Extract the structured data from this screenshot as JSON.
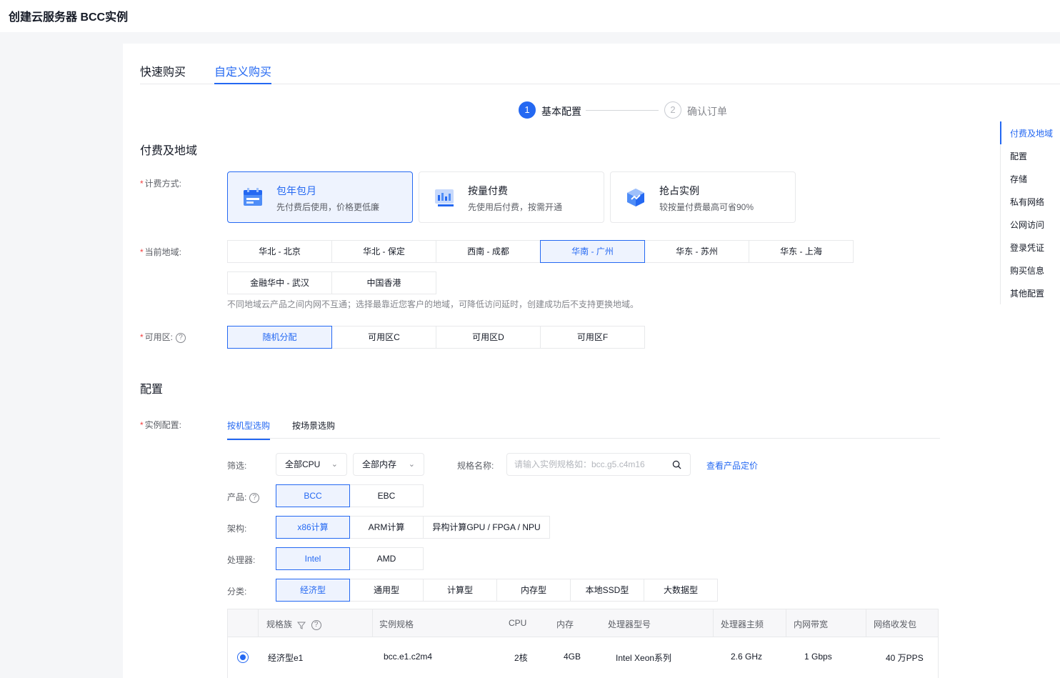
{
  "page": {
    "title": "创建云服务器 BCC实例"
  },
  "tabs": [
    {
      "label": "快速购买",
      "active": false
    },
    {
      "label": "自定义购买",
      "active": true
    }
  ],
  "steps": [
    {
      "num": "1",
      "label": "基本配置",
      "active": true
    },
    {
      "num": "2",
      "label": "确认订单",
      "active": false
    }
  ],
  "sections": {
    "billing_region": "付费及地域",
    "config": "配置"
  },
  "billing": {
    "label": "计费方式:",
    "options": [
      {
        "title": "包年包月",
        "desc": "先付费后使用，价格更低廉",
        "selected": true,
        "icon": "calendar-icon"
      },
      {
        "title": "按量付费",
        "desc": "先使用后付费，按需开通",
        "selected": false,
        "icon": "meter-icon"
      },
      {
        "title": "抢占实例",
        "desc": "较按量付费最高可省90%",
        "selected": false,
        "icon": "cube-icon"
      }
    ]
  },
  "region": {
    "label": "当前地域:",
    "row1": [
      "华北 - 北京",
      "华北 - 保定",
      "西南 - 成都",
      "华南 - 广州",
      "华东 - 苏州",
      "华东 - 上海"
    ],
    "row2": [
      "金融华中 - 武汉",
      "中国香港"
    ],
    "selected": "华南 - 广州",
    "hint": "不同地域云产品之间内网不互通；选择最靠近您客户的地域，可降低访问延时，创建成功后不支持更换地域。"
  },
  "zone": {
    "label": "可用区:",
    "options": [
      "随机分配",
      "可用区C",
      "可用区D",
      "可用区F"
    ],
    "selected": "随机分配"
  },
  "instance": {
    "label": "实例配置:",
    "subtabs": [
      {
        "label": "按机型选购",
        "active": true
      },
      {
        "label": "按场景选购",
        "active": false
      }
    ],
    "filter_label": "筛选:",
    "cpu_select": "全部CPU",
    "mem_select": "全部内存",
    "spec_name_label": "规格名称:",
    "search_placeholder": "请输入实例规格如：bcc.g5.c4m16",
    "price_link": "查看产品定价",
    "product": {
      "label": "产品:",
      "options": [
        "BCC",
        "EBC"
      ],
      "selected": "BCC"
    },
    "arch": {
      "label": "架构:",
      "options": [
        "x86计算",
        "ARM计算",
        "异构计算GPU / FPGA / NPU"
      ],
      "selected": "x86计算"
    },
    "cpu_vendor": {
      "label": "处理器:",
      "options": [
        "Intel",
        "AMD"
      ],
      "selected": "Intel"
    },
    "category": {
      "label": "分类:",
      "options": [
        "经济型",
        "通用型",
        "计算型",
        "内存型",
        "本地SSD型",
        "大数据型"
      ],
      "selected": "经济型"
    }
  },
  "table": {
    "headers": [
      "规格族",
      "实例规格",
      "CPU",
      "内存",
      "处理器型号",
      "处理器主频",
      "内网带宽",
      "网络收发包"
    ],
    "rows": [
      {
        "family": "经济型e1",
        "spec": "bcc.e1.c2m4",
        "cpu": "2核",
        "mem": "4GB",
        "processor": "Intel Xeon系列",
        "freq": "2.6 GHz",
        "bandwidth": "1 Gbps",
        "pps": "40 万PPS",
        "selected": true
      }
    ]
  },
  "anchor_nav": {
    "items": [
      "付费及地域",
      "配置",
      "存储",
      "私有网络",
      "公网访问",
      "登录凭证",
      "购买信息",
      "其他配置"
    ],
    "active": "付费及地域"
  },
  "colors": {
    "accent": "#2468f2",
    "required": "#f33e3e"
  }
}
